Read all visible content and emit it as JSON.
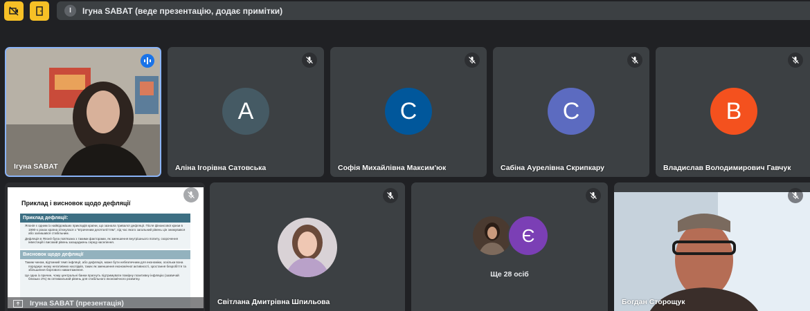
{
  "banner": {
    "avatar_letter": "І",
    "text": "Ігуна SABAT (веде презентацію, додає примітки)"
  },
  "participants": [
    {
      "name": "Ігуна SABAT",
      "type": "video",
      "speaking": true
    },
    {
      "name": "Аліна Ігорівна Сатовська",
      "initial": "A",
      "avatar_color": "#455a64",
      "muted": true
    },
    {
      "name": "Софія Михайлівна Максим'юк",
      "initial": "C",
      "avatar_color": "#01579b",
      "muted": true
    },
    {
      "name": "Сабіна Аурелівна Скрипкару",
      "initial": "C",
      "avatar_color": "#5c6bc0",
      "muted": true
    },
    {
      "name": "Владислав Володимирович Гавчук",
      "initial": "B",
      "avatar_color": "#f4511e",
      "muted": true
    }
  ],
  "presentation": {
    "owner_label": "Ігуна SABAT (презентація)",
    "slide": {
      "title": "Приклад і висновок щодо дефляції",
      "section1_heading": "Приклад дефляції:",
      "section1_points": [
        "Японія є одним із найвідоміших прикладів країни, що зазнала тривалої дефляції. Після фінансової кризи в 1990-х роках країна зіткнулася з \"втраченим десятиліттям\", під час якого загальний рівень цін знижувався або залишався стабільним.",
        "Дефляція в Японії була пов'язана з такими факторами, як зменшення внутрішнього попиту, скорочення інвестицій і високий рівень заощаджень серед населення."
      ],
      "section2_heading": "Висновок щодо дефляції",
      "section2_points": [
        "Таким чином, від'ємний темп інфляції, або дефляція, може бути небезпечним для економіки, оскільки вона породжує низку негативних наслідків, таких як зменшення економічної активності, зростання безробіття та збільшення боргового навантаження.",
        "Це одна із причин, чому центральні банки прагнуть підтримувати помірну позитивну інфляцію (зазвичай близько 2%) як оптимальний рівень для стабільного економічного розвитку."
      ]
    }
  },
  "svitlana": {
    "name": "Світлана Дмитрівна Шпильова",
    "muted": true
  },
  "others": {
    "initial": "Є",
    "avatar_color": "#7b3fb5",
    "label": "Ще 28 осіб"
  },
  "bohdan": {
    "name": "Богдан Сторощук",
    "muted": true
  }
}
